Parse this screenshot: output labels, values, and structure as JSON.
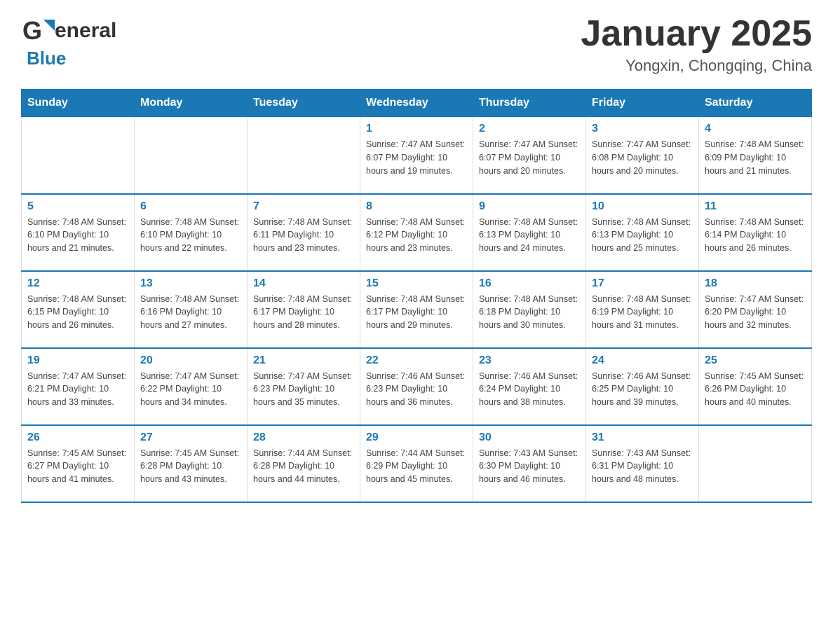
{
  "header": {
    "logo_general": "General",
    "logo_blue": "Blue",
    "month_title": "January 2025",
    "location": "Yongxin, Chongqing, China"
  },
  "days_of_week": [
    "Sunday",
    "Monday",
    "Tuesday",
    "Wednesday",
    "Thursday",
    "Friday",
    "Saturday"
  ],
  "weeks": [
    [
      {
        "day": "",
        "info": ""
      },
      {
        "day": "",
        "info": ""
      },
      {
        "day": "",
        "info": ""
      },
      {
        "day": "1",
        "info": "Sunrise: 7:47 AM\nSunset: 6:07 PM\nDaylight: 10 hours\nand 19 minutes."
      },
      {
        "day": "2",
        "info": "Sunrise: 7:47 AM\nSunset: 6:07 PM\nDaylight: 10 hours\nand 20 minutes."
      },
      {
        "day": "3",
        "info": "Sunrise: 7:47 AM\nSunset: 6:08 PM\nDaylight: 10 hours\nand 20 minutes."
      },
      {
        "day": "4",
        "info": "Sunrise: 7:48 AM\nSunset: 6:09 PM\nDaylight: 10 hours\nand 21 minutes."
      }
    ],
    [
      {
        "day": "5",
        "info": "Sunrise: 7:48 AM\nSunset: 6:10 PM\nDaylight: 10 hours\nand 21 minutes."
      },
      {
        "day": "6",
        "info": "Sunrise: 7:48 AM\nSunset: 6:10 PM\nDaylight: 10 hours\nand 22 minutes."
      },
      {
        "day": "7",
        "info": "Sunrise: 7:48 AM\nSunset: 6:11 PM\nDaylight: 10 hours\nand 23 minutes."
      },
      {
        "day": "8",
        "info": "Sunrise: 7:48 AM\nSunset: 6:12 PM\nDaylight: 10 hours\nand 23 minutes."
      },
      {
        "day": "9",
        "info": "Sunrise: 7:48 AM\nSunset: 6:13 PM\nDaylight: 10 hours\nand 24 minutes."
      },
      {
        "day": "10",
        "info": "Sunrise: 7:48 AM\nSunset: 6:13 PM\nDaylight: 10 hours\nand 25 minutes."
      },
      {
        "day": "11",
        "info": "Sunrise: 7:48 AM\nSunset: 6:14 PM\nDaylight: 10 hours\nand 26 minutes."
      }
    ],
    [
      {
        "day": "12",
        "info": "Sunrise: 7:48 AM\nSunset: 6:15 PM\nDaylight: 10 hours\nand 26 minutes."
      },
      {
        "day": "13",
        "info": "Sunrise: 7:48 AM\nSunset: 6:16 PM\nDaylight: 10 hours\nand 27 minutes."
      },
      {
        "day": "14",
        "info": "Sunrise: 7:48 AM\nSunset: 6:17 PM\nDaylight: 10 hours\nand 28 minutes."
      },
      {
        "day": "15",
        "info": "Sunrise: 7:48 AM\nSunset: 6:17 PM\nDaylight: 10 hours\nand 29 minutes."
      },
      {
        "day": "16",
        "info": "Sunrise: 7:48 AM\nSunset: 6:18 PM\nDaylight: 10 hours\nand 30 minutes."
      },
      {
        "day": "17",
        "info": "Sunrise: 7:48 AM\nSunset: 6:19 PM\nDaylight: 10 hours\nand 31 minutes."
      },
      {
        "day": "18",
        "info": "Sunrise: 7:47 AM\nSunset: 6:20 PM\nDaylight: 10 hours\nand 32 minutes."
      }
    ],
    [
      {
        "day": "19",
        "info": "Sunrise: 7:47 AM\nSunset: 6:21 PM\nDaylight: 10 hours\nand 33 minutes."
      },
      {
        "day": "20",
        "info": "Sunrise: 7:47 AM\nSunset: 6:22 PM\nDaylight: 10 hours\nand 34 minutes."
      },
      {
        "day": "21",
        "info": "Sunrise: 7:47 AM\nSunset: 6:23 PM\nDaylight: 10 hours\nand 35 minutes."
      },
      {
        "day": "22",
        "info": "Sunrise: 7:46 AM\nSunset: 6:23 PM\nDaylight: 10 hours\nand 36 minutes."
      },
      {
        "day": "23",
        "info": "Sunrise: 7:46 AM\nSunset: 6:24 PM\nDaylight: 10 hours\nand 38 minutes."
      },
      {
        "day": "24",
        "info": "Sunrise: 7:46 AM\nSunset: 6:25 PM\nDaylight: 10 hours\nand 39 minutes."
      },
      {
        "day": "25",
        "info": "Sunrise: 7:45 AM\nSunset: 6:26 PM\nDaylight: 10 hours\nand 40 minutes."
      }
    ],
    [
      {
        "day": "26",
        "info": "Sunrise: 7:45 AM\nSunset: 6:27 PM\nDaylight: 10 hours\nand 41 minutes."
      },
      {
        "day": "27",
        "info": "Sunrise: 7:45 AM\nSunset: 6:28 PM\nDaylight: 10 hours\nand 43 minutes."
      },
      {
        "day": "28",
        "info": "Sunrise: 7:44 AM\nSunset: 6:28 PM\nDaylight: 10 hours\nand 44 minutes."
      },
      {
        "day": "29",
        "info": "Sunrise: 7:44 AM\nSunset: 6:29 PM\nDaylight: 10 hours\nand 45 minutes."
      },
      {
        "day": "30",
        "info": "Sunrise: 7:43 AM\nSunset: 6:30 PM\nDaylight: 10 hours\nand 46 minutes."
      },
      {
        "day": "31",
        "info": "Sunrise: 7:43 AM\nSunset: 6:31 PM\nDaylight: 10 hours\nand 48 minutes."
      },
      {
        "day": "",
        "info": ""
      }
    ]
  ]
}
